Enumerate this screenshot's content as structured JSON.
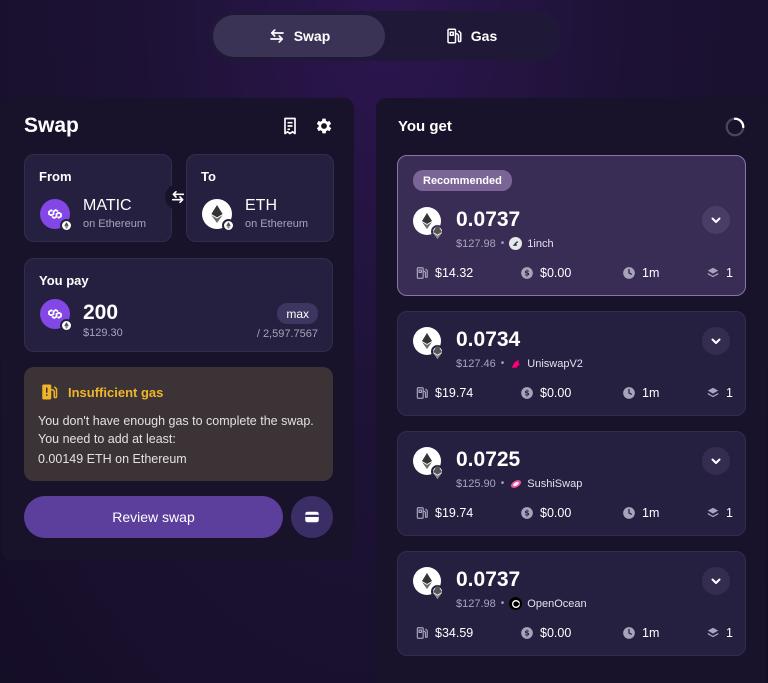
{
  "toggle": {
    "swap_label": "Swap",
    "gas_label": "Gas"
  },
  "swap": {
    "title": "Swap",
    "from": {
      "label": "From",
      "symbol": "MATIC",
      "chain": "on Ethereum"
    },
    "to": {
      "label": "To",
      "symbol": "ETH",
      "chain": "on Ethereum"
    },
    "pay": {
      "label": "You pay",
      "amount": "200",
      "usd": "$129.30",
      "max_label": "max",
      "balance": "/ 2,597.7567"
    },
    "warning": {
      "title": "Insufficient gas",
      "text": "You don't have enough gas to complete the swap. You need to add at least:",
      "required": "0.00149 ETH on Ethereum"
    },
    "review_label": "Review swap"
  },
  "routes_panel": {
    "title": "You get",
    "recommended_label": "Recommended",
    "routes": [
      {
        "amount": "0.0737",
        "usd": "$127.98",
        "provider": "1inch",
        "gas": "$14.32",
        "fee": "$0.00",
        "time": "1m",
        "steps": "1"
      },
      {
        "amount": "0.0734",
        "usd": "$127.46",
        "provider": "UniswapV2",
        "gas": "$19.74",
        "fee": "$0.00",
        "time": "1m",
        "steps": "1"
      },
      {
        "amount": "0.0725",
        "usd": "$125.90",
        "provider": "SushiSwap",
        "gas": "$19.74",
        "fee": "$0.00",
        "time": "1m",
        "steps": "1"
      },
      {
        "amount": "0.0737",
        "usd": "$127.98",
        "provider": "OpenOcean",
        "gas": "$34.59",
        "fee": "$0.00",
        "time": "1m",
        "steps": "1"
      }
    ]
  },
  "colors": {
    "accent": "#5c3f9c",
    "warning": "#f0b429",
    "matic": "#8247e5"
  }
}
